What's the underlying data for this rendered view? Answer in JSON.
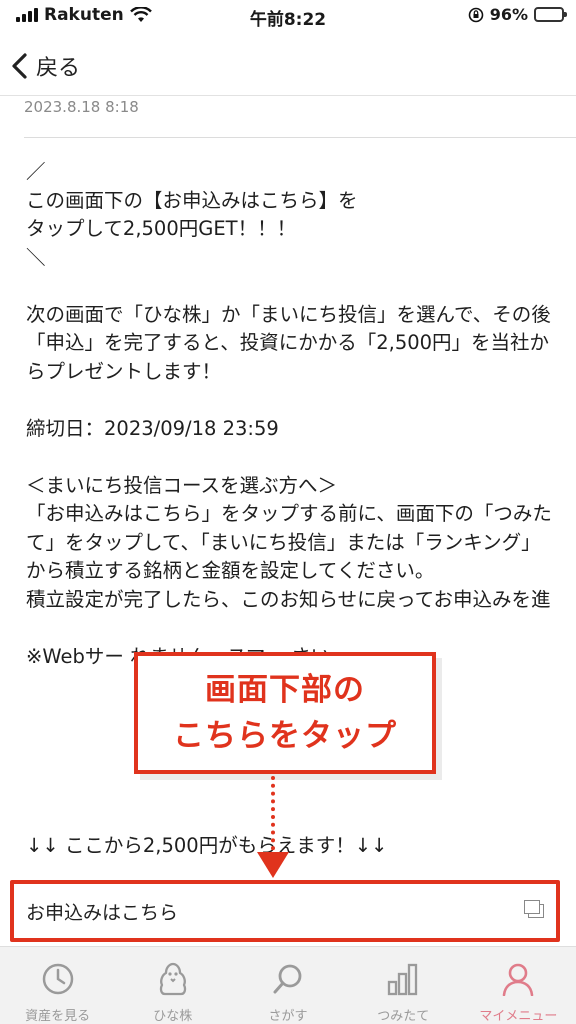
{
  "status_bar": {
    "carrier": "Rakuten",
    "time": "午前8:22",
    "battery": "96%"
  },
  "nav": {
    "back_label": "戻る"
  },
  "message": {
    "date": "2023.8.18 8:18",
    "paragraphs": [
      "／\nこの画面下の【お申込みはこちら】を\nタップして2,500円GET！！！\n＼",
      "次の画面で「ひな株」か「まいにち投信」を選んで、その後「申込」を完了すると、投資にかかる「2,500円」を当社からプレゼントします！",
      "締切日：2023/09/18 23:59",
      "＜まいにち投信コースを選ぶ方へ＞\n「お申込みはこちら」をタップする前に、画面下の「つみたて」をタップして、「まいにち投信」または「ランキング」から積立する銘柄と金額を設定してください。\n積立設定が完了したら、このお知らせに戻ってお申込みを進",
      "※Webサー                            れません。スマー                            さい。"
    ],
    "cta_text": "↓↓ ここから2,500円がもらえます！↓↓"
  },
  "apply_button": {
    "label": "お申込みはこちら"
  },
  "callout": {
    "line1": "画面下部の",
    "line2": "こちらをタップ"
  },
  "tabs": [
    {
      "label": "資産を見る",
      "icon": "clock-icon"
    },
    {
      "label": "ひな株",
      "icon": "chick-icon"
    },
    {
      "label": "さがす",
      "icon": "search-icon"
    },
    {
      "label": "つみたて",
      "icon": "bar-chart-icon"
    },
    {
      "label": "マイメニュー",
      "icon": "person-icon",
      "active": true
    }
  ],
  "colors": {
    "accent": "#e0331d",
    "active_tab": "#e07c8a",
    "inactive_tab": "#9a9a9a"
  }
}
